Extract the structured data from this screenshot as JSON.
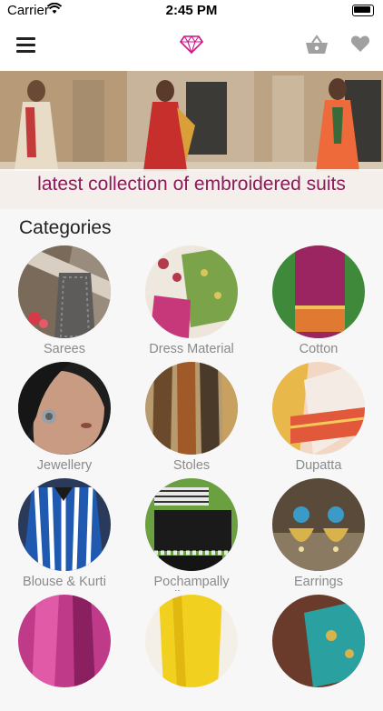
{
  "status_bar": {
    "carrier": "Carrier",
    "time": "2:45 PM"
  },
  "banner": {
    "caption": "latest collection of embroidered suits"
  },
  "section_title": "Categories",
  "categories": [
    {
      "label": "Sarees"
    },
    {
      "label": "Dress Material"
    },
    {
      "label": "Cotton"
    },
    {
      "label": "Jewellery"
    },
    {
      "label": "Stoles"
    },
    {
      "label": "Dupatta"
    },
    {
      "label": "Blouse & Kurti"
    },
    {
      "label": "Pochampally Handloom Pure"
    },
    {
      "label": "Earrings"
    },
    {
      "label": ""
    },
    {
      "label": ""
    },
    {
      "label": ""
    }
  ],
  "colors": {
    "accent": "#d0118a",
    "caption": "#8b1a5a",
    "icon_gray": "#a0a0a0"
  },
  "icons": [
    "wifi-icon",
    "battery-icon",
    "menu-icon",
    "diamond-icon",
    "basket-icon",
    "heart-icon"
  ]
}
